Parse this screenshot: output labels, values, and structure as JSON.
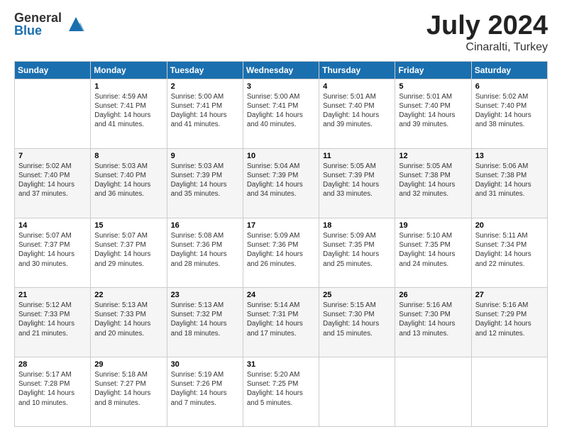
{
  "logo": {
    "general": "General",
    "blue": "Blue"
  },
  "header": {
    "month": "July 2024",
    "location": "Cinaralti, Turkey"
  },
  "weekdays": [
    "Sunday",
    "Monday",
    "Tuesday",
    "Wednesday",
    "Thursday",
    "Friday",
    "Saturday"
  ],
  "weeks": [
    [
      {
        "day": "",
        "info": ""
      },
      {
        "day": "1",
        "info": "Sunrise: 4:59 AM\nSunset: 7:41 PM\nDaylight: 14 hours\nand 41 minutes."
      },
      {
        "day": "2",
        "info": "Sunrise: 5:00 AM\nSunset: 7:41 PM\nDaylight: 14 hours\nand 41 minutes."
      },
      {
        "day": "3",
        "info": "Sunrise: 5:00 AM\nSunset: 7:41 PM\nDaylight: 14 hours\nand 40 minutes."
      },
      {
        "day": "4",
        "info": "Sunrise: 5:01 AM\nSunset: 7:40 PM\nDaylight: 14 hours\nand 39 minutes."
      },
      {
        "day": "5",
        "info": "Sunrise: 5:01 AM\nSunset: 7:40 PM\nDaylight: 14 hours\nand 39 minutes."
      },
      {
        "day": "6",
        "info": "Sunrise: 5:02 AM\nSunset: 7:40 PM\nDaylight: 14 hours\nand 38 minutes."
      }
    ],
    [
      {
        "day": "7",
        "info": "Sunrise: 5:02 AM\nSunset: 7:40 PM\nDaylight: 14 hours\nand 37 minutes."
      },
      {
        "day": "8",
        "info": "Sunrise: 5:03 AM\nSunset: 7:40 PM\nDaylight: 14 hours\nand 36 minutes."
      },
      {
        "day": "9",
        "info": "Sunrise: 5:03 AM\nSunset: 7:39 PM\nDaylight: 14 hours\nand 35 minutes."
      },
      {
        "day": "10",
        "info": "Sunrise: 5:04 AM\nSunset: 7:39 PM\nDaylight: 14 hours\nand 34 minutes."
      },
      {
        "day": "11",
        "info": "Sunrise: 5:05 AM\nSunset: 7:39 PM\nDaylight: 14 hours\nand 33 minutes."
      },
      {
        "day": "12",
        "info": "Sunrise: 5:05 AM\nSunset: 7:38 PM\nDaylight: 14 hours\nand 32 minutes."
      },
      {
        "day": "13",
        "info": "Sunrise: 5:06 AM\nSunset: 7:38 PM\nDaylight: 14 hours\nand 31 minutes."
      }
    ],
    [
      {
        "day": "14",
        "info": "Sunrise: 5:07 AM\nSunset: 7:37 PM\nDaylight: 14 hours\nand 30 minutes."
      },
      {
        "day": "15",
        "info": "Sunrise: 5:07 AM\nSunset: 7:37 PM\nDaylight: 14 hours\nand 29 minutes."
      },
      {
        "day": "16",
        "info": "Sunrise: 5:08 AM\nSunset: 7:36 PM\nDaylight: 14 hours\nand 28 minutes."
      },
      {
        "day": "17",
        "info": "Sunrise: 5:09 AM\nSunset: 7:36 PM\nDaylight: 14 hours\nand 26 minutes."
      },
      {
        "day": "18",
        "info": "Sunrise: 5:09 AM\nSunset: 7:35 PM\nDaylight: 14 hours\nand 25 minutes."
      },
      {
        "day": "19",
        "info": "Sunrise: 5:10 AM\nSunset: 7:35 PM\nDaylight: 14 hours\nand 24 minutes."
      },
      {
        "day": "20",
        "info": "Sunrise: 5:11 AM\nSunset: 7:34 PM\nDaylight: 14 hours\nand 22 minutes."
      }
    ],
    [
      {
        "day": "21",
        "info": "Sunrise: 5:12 AM\nSunset: 7:33 PM\nDaylight: 14 hours\nand 21 minutes."
      },
      {
        "day": "22",
        "info": "Sunrise: 5:13 AM\nSunset: 7:33 PM\nDaylight: 14 hours\nand 20 minutes."
      },
      {
        "day": "23",
        "info": "Sunrise: 5:13 AM\nSunset: 7:32 PM\nDaylight: 14 hours\nand 18 minutes."
      },
      {
        "day": "24",
        "info": "Sunrise: 5:14 AM\nSunset: 7:31 PM\nDaylight: 14 hours\nand 17 minutes."
      },
      {
        "day": "25",
        "info": "Sunrise: 5:15 AM\nSunset: 7:30 PM\nDaylight: 14 hours\nand 15 minutes."
      },
      {
        "day": "26",
        "info": "Sunrise: 5:16 AM\nSunset: 7:30 PM\nDaylight: 14 hours\nand 13 minutes."
      },
      {
        "day": "27",
        "info": "Sunrise: 5:16 AM\nSunset: 7:29 PM\nDaylight: 14 hours\nand 12 minutes."
      }
    ],
    [
      {
        "day": "28",
        "info": "Sunrise: 5:17 AM\nSunset: 7:28 PM\nDaylight: 14 hours\nand 10 minutes."
      },
      {
        "day": "29",
        "info": "Sunrise: 5:18 AM\nSunset: 7:27 PM\nDaylight: 14 hours\nand 8 minutes."
      },
      {
        "day": "30",
        "info": "Sunrise: 5:19 AM\nSunset: 7:26 PM\nDaylight: 14 hours\nand 7 minutes."
      },
      {
        "day": "31",
        "info": "Sunrise: 5:20 AM\nSunset: 7:25 PM\nDaylight: 14 hours\nand 5 minutes."
      },
      {
        "day": "",
        "info": ""
      },
      {
        "day": "",
        "info": ""
      },
      {
        "day": "",
        "info": ""
      }
    ]
  ]
}
